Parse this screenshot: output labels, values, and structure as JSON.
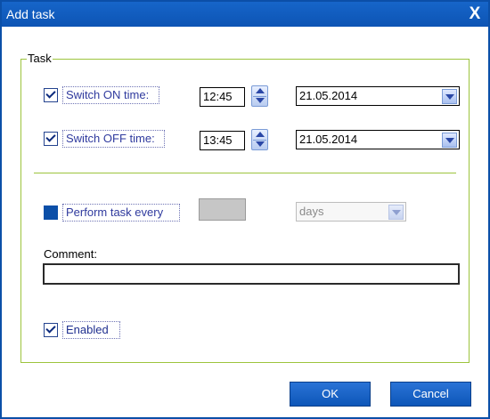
{
  "window": {
    "title": "Add task",
    "close_glyph": "X"
  },
  "group": {
    "title": "Task"
  },
  "switch_on": {
    "checked": true,
    "label": "Switch ON time:",
    "time": "12:45",
    "date": "21.05.2014"
  },
  "switch_off": {
    "checked": true,
    "label": "Switch OFF time:",
    "time": "13:45",
    "date": "21.05.2014"
  },
  "perform": {
    "checked": false,
    "label": "Perform task every",
    "interval": "",
    "unit": "days",
    "enabled": false
  },
  "comment": {
    "label": "Comment:",
    "value": "",
    "placeholder": ""
  },
  "enabled": {
    "checked": true,
    "label": "Enabled"
  },
  "buttons": {
    "ok": "OK",
    "cancel": "Cancel"
  },
  "colors": {
    "titlebar": "#0d54b4",
    "group_border": "#9dc43d",
    "label_text": "#2f3a9e",
    "button": "#0d56b8"
  },
  "icons": {
    "close": "close-icon",
    "checkbox": "checkmark-icon",
    "spinner": "spin-up-down-icon",
    "dropdown": "chevron-down-icon"
  }
}
